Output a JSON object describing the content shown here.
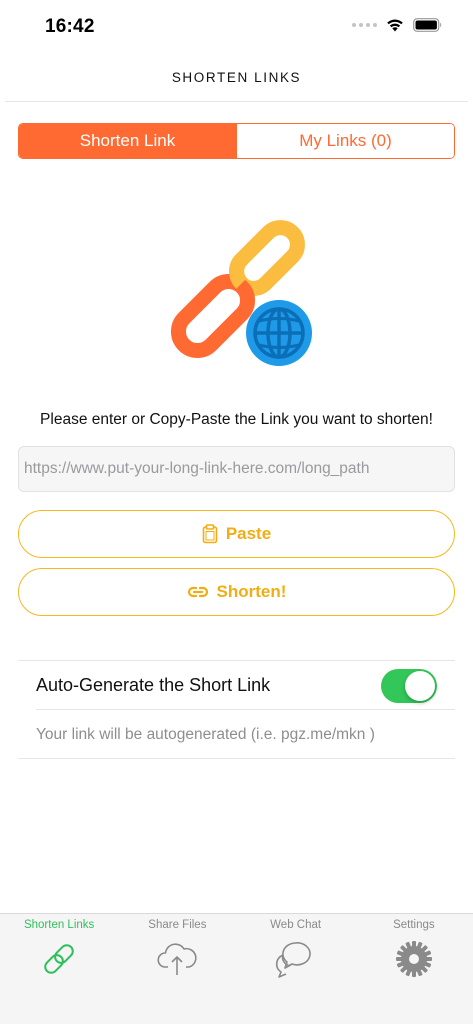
{
  "status_bar": {
    "time": "16:42"
  },
  "nav": {
    "title": "SHORTEN LINKS"
  },
  "segments": {
    "shorten_link": "Shorten Link",
    "my_links": "My Links (0)"
  },
  "prompt": "Please enter or Copy-Paste the Link you want to shorten!",
  "url_input": {
    "value": "",
    "placeholder": "https://www.put-your-long-link-here.com/long_path"
  },
  "buttons": {
    "paste": "Paste",
    "shorten": "Shorten!"
  },
  "settings": {
    "auto_generate_label": "Auto-Generate the Short Link",
    "auto_generate_on": true,
    "hint": "Your link will be autogenerated (i.e. pgz.me/mkn )"
  },
  "tabs": [
    {
      "label": "Shorten Links",
      "icon": "link-icon",
      "active": true
    },
    {
      "label": "Share Files",
      "icon": "cloud-upload-icon",
      "active": false
    },
    {
      "label": "Web Chat",
      "icon": "chat-bubbles-icon",
      "active": false
    },
    {
      "label": "Settings",
      "icon": "gear-icon",
      "active": false
    }
  ],
  "colors": {
    "accent_orange": "#ff6a33",
    "button_yellow": "#f7b81d",
    "toggle_green": "#33c759",
    "tab_active_green": "#2fbf5b",
    "globe_blue": "#1e9ae8"
  }
}
